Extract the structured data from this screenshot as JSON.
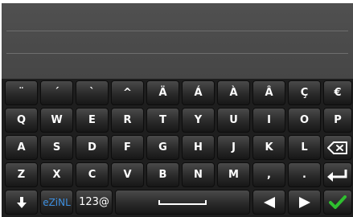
{
  "keyboard": {
    "row1": [
      "¨",
      "´",
      "`",
      "^",
      "Ä",
      "Á",
      "À",
      "Â",
      "Ç",
      "€"
    ],
    "row2": [
      "Q",
      "W",
      "E",
      "R",
      "T",
      "Y",
      "U",
      "I",
      "O",
      "P"
    ],
    "row3": [
      "A",
      "S",
      "D",
      "F",
      "G",
      "H",
      "J",
      "K",
      "L"
    ],
    "row4": [
      "Z",
      "X",
      "C",
      "V",
      "B",
      "N",
      "M",
      ",",
      "."
    ],
    "ime_label": "eZiNL",
    "numeric_label": "123@"
  },
  "icons": {
    "backspace": "backspace-icon",
    "enter": "enter-icon",
    "shift": "shift-down-icon",
    "space": "space-icon",
    "left": "arrow-left-icon",
    "right": "arrow-right-icon",
    "confirm": "checkmark-icon"
  },
  "colors": {
    "key_text": "#ffffff",
    "ime_label": "#3d8fe0",
    "confirm_check": "#2fbf2f"
  }
}
